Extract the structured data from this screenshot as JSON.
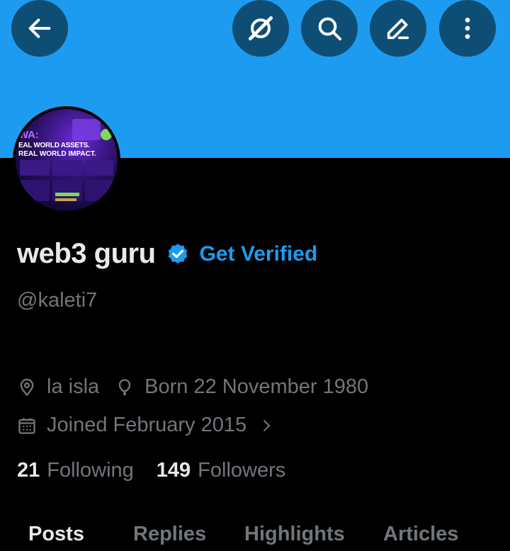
{
  "header": {
    "back_icon": "arrow-left-icon",
    "actions": [
      {
        "name": "grok-icon"
      },
      {
        "name": "search-icon"
      },
      {
        "name": "edit-icon"
      },
      {
        "name": "more-icon"
      }
    ],
    "banner_color": "#1d9bf0"
  },
  "avatar": {
    "line1": "WA:",
    "line2": "EAL WORLD ASSETS.",
    "line3": "REAL WORLD IMPACT."
  },
  "profile": {
    "display_name": "web3 guru",
    "get_verified": "Get Verified",
    "handle": "@kaleti7",
    "location": "la isla",
    "born": "Born 22 November 1980",
    "joined": "Joined February 2015"
  },
  "stats": {
    "following_count": "21",
    "following_label": "Following",
    "followers_count": "149",
    "followers_label": "Followers"
  },
  "tabs": [
    {
      "label": "Posts"
    },
    {
      "label": "Replies"
    },
    {
      "label": "Highlights"
    },
    {
      "label": "Articles"
    }
  ],
  "colors": {
    "accent": "#1d9bf0",
    "muted": "#71767b",
    "text": "#e7e9ea"
  }
}
